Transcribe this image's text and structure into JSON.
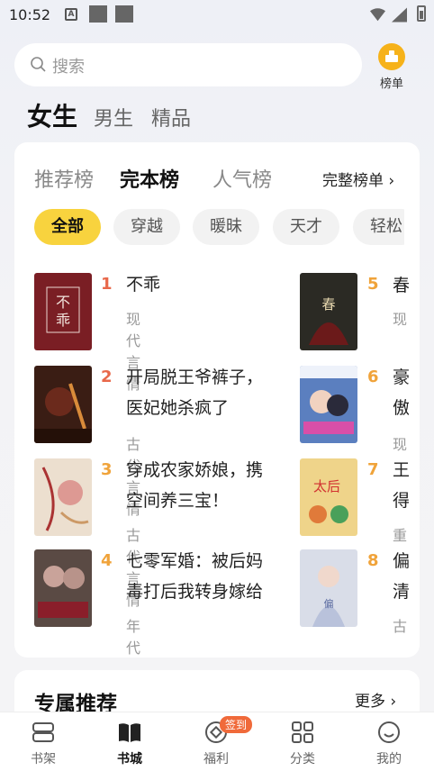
{
  "status_bar": {
    "time": "10:52"
  },
  "search": {
    "placeholder": "搜索"
  },
  "rank_button": {
    "label": "榜单"
  },
  "gender_tabs": [
    "女生",
    "男生",
    "精品"
  ],
  "rank_tabs": [
    "推荐榜",
    "完本榜",
    "人气榜"
  ],
  "full_list_label": "完整榜单 ›",
  "chips": [
    "全部",
    "穿越",
    "暖昧",
    "天才",
    "轻松"
  ],
  "books": [
    {
      "rank": "1",
      "title": "不乖",
      "category": "现代言情",
      "cover_color": "#7a1e24"
    },
    {
      "rank": "2",
      "title": "开局脱王爷裤子，医妃她杀疯了",
      "category": "古代言情",
      "cover_color": "#3a1d14"
    },
    {
      "rank": "3",
      "title": "穿成农家娇娘，携空间养三宝！",
      "category": "古代言情",
      "cover_color": "#e8d9c8"
    },
    {
      "rank": "4",
      "title": "七零军婚：被后妈毒打后我转身嫁给",
      "category": "年代",
      "cover_color": "#5a4a44"
    },
    {
      "rank": "5",
      "title": "春",
      "category": "现",
      "cover_color": "#2b2a24"
    },
    {
      "rank": "6",
      "title": "豪傲",
      "category": "现",
      "cover_color": "#5b7fbf"
    },
    {
      "rank": "7",
      "title": "王得",
      "category": "重",
      "cover_color": "#efd48a"
    },
    {
      "rank": "8",
      "title": "偏清",
      "category": "古",
      "cover_color": "#d9dde8"
    }
  ],
  "recommend": {
    "title": "专属推荐",
    "more": "更多 ›"
  },
  "nav": [
    {
      "label": "书架",
      "icon": "bookshelf-icon"
    },
    {
      "label": "书城",
      "icon": "bookstore-icon"
    },
    {
      "label": "福利",
      "icon": "welfare-icon",
      "badge": "签到"
    },
    {
      "label": "分类",
      "icon": "category-icon"
    },
    {
      "label": "我的",
      "icon": "profile-icon"
    }
  ],
  "colors": {
    "accent_yellow": "#f8d33e",
    "rank_orange": "#f0a33a",
    "badge_red": "#f06a3a"
  }
}
